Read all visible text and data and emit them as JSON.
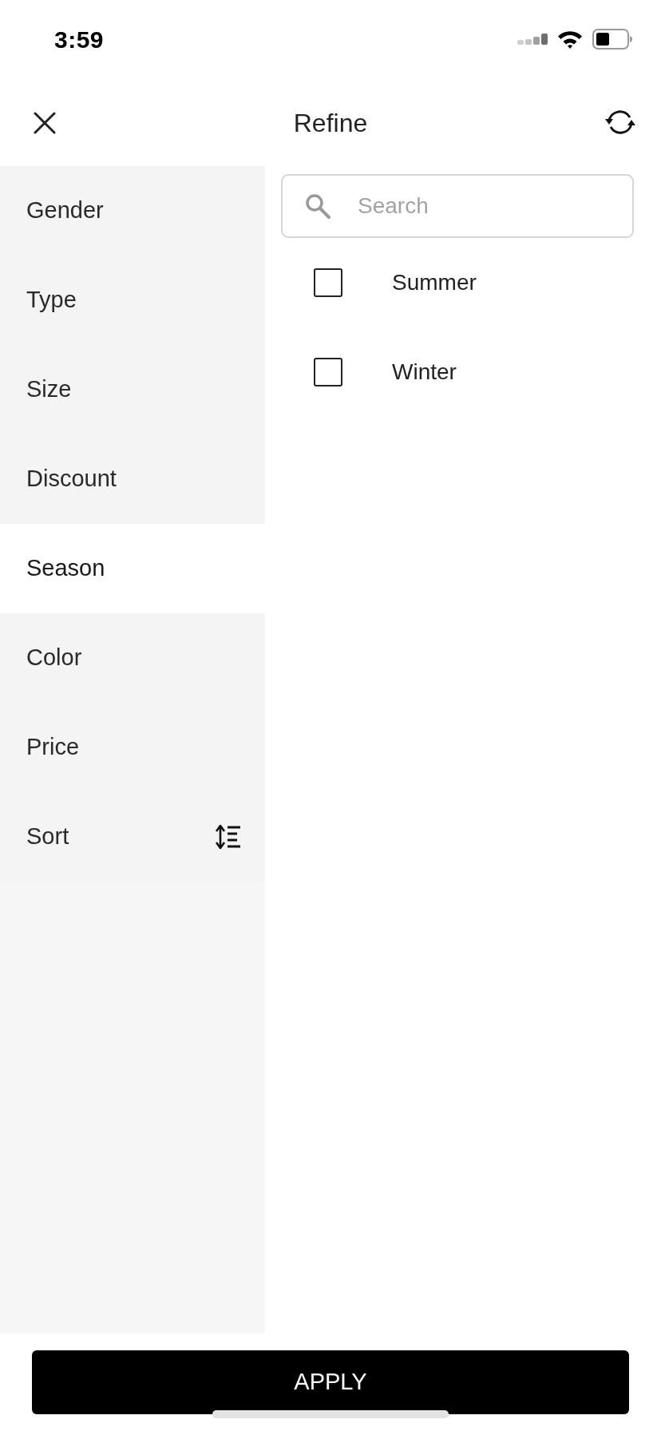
{
  "status_bar": {
    "time": "3:59"
  },
  "header": {
    "title": "Refine"
  },
  "categories": [
    {
      "label": "Gender",
      "selected": false,
      "kind": "filter"
    },
    {
      "label": "Type",
      "selected": false,
      "kind": "filter"
    },
    {
      "label": "Size",
      "selected": false,
      "kind": "filter"
    },
    {
      "label": "Discount",
      "selected": false,
      "kind": "filter"
    },
    {
      "label": "Season",
      "selected": true,
      "kind": "filter"
    },
    {
      "label": "Color",
      "selected": false,
      "kind": "filter"
    },
    {
      "label": "Price",
      "selected": false,
      "kind": "filter"
    },
    {
      "label": "Sort",
      "selected": false,
      "kind": "sort"
    }
  ],
  "search": {
    "placeholder": "Search"
  },
  "options": [
    {
      "label": "Summer",
      "checked": false
    },
    {
      "label": "Winter",
      "checked": false
    }
  ],
  "apply_button": {
    "label": "APPLY"
  }
}
